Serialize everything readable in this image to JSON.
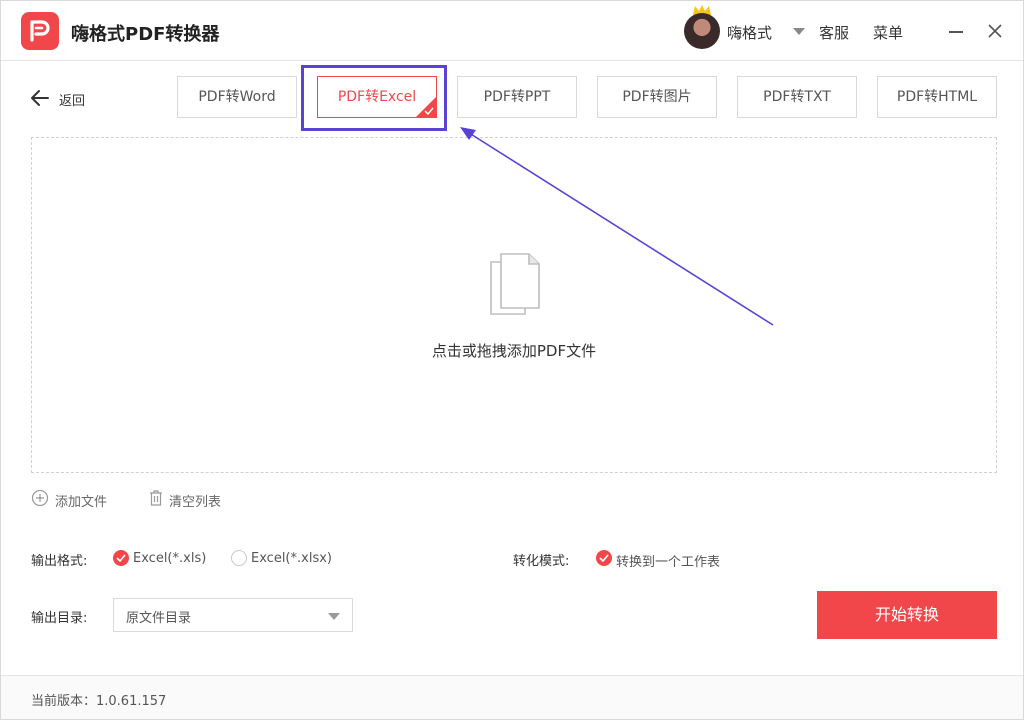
{
  "app": {
    "title": "嗨格式PDF转换器",
    "brand_color": "#f2474a",
    "logo_icon": "pdf-logo-icon"
  },
  "header": {
    "username": "嗨格式",
    "service_label": "客服",
    "menu_label": "菜单"
  },
  "nav": {
    "back_label": "返回",
    "tabs": [
      {
        "label": "PDF转Word",
        "active": false
      },
      {
        "label": "PDF转Excel",
        "active": true
      },
      {
        "label": "PDF转PPT",
        "active": false
      },
      {
        "label": "PDF转图片",
        "active": false
      },
      {
        "label": "PDF转TXT",
        "active": false
      },
      {
        "label": "PDF转HTML",
        "active": false
      }
    ]
  },
  "dropzone": {
    "text": "点击或拖拽添加PDF文件",
    "icon": "document-icon"
  },
  "file_actions": {
    "add_label": "添加文件",
    "clear_label": "清空列表"
  },
  "options": {
    "output_format_label": "输出格式:",
    "formats": [
      {
        "label": "Excel(*.xls)",
        "selected": true
      },
      {
        "label": "Excel(*.xlsx)",
        "selected": false
      }
    ],
    "mode_label": "转化模式:",
    "mode_option": {
      "label": "转换到一个工作表",
      "selected": true
    },
    "output_dir_label": "输出目录:",
    "output_dir_value": "原文件目录"
  },
  "actions": {
    "start_label": "开始转换"
  },
  "footer": {
    "version_text": "当前版本：1.0.61.157"
  },
  "annotation": {
    "highlight_color": "#5a42d6"
  }
}
